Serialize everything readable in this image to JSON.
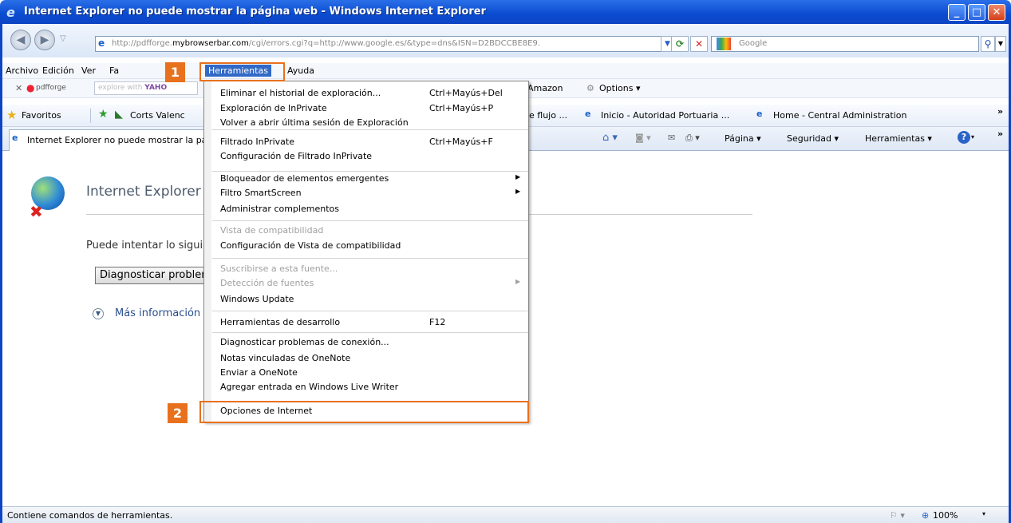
{
  "window": {
    "title": "Internet Explorer no puede mostrar la página web - Windows Internet Explorer",
    "address_prefix": "http://pdfforge.",
    "address_domain": "mybrowserbar.com",
    "address_suffix": "/cgi/errors.cgi?q=http://www.google.es/&type=dns&ISN=D2BDCCBE8E9.",
    "search_placeholder": "Google"
  },
  "menubar": {
    "items": [
      "Archivo",
      "Edición",
      "Ver",
      "Fa",
      "Herramientas",
      "Ayuda"
    ]
  },
  "toolbar2": {
    "close": "✕",
    "brand": "pdfforge",
    "search_placeholder": "explore with",
    "yahoo": "YAHO",
    "amazon": "Amazon",
    "options": "Options ▾"
  },
  "favorites": {
    "label": "Favoritos",
    "items": [
      "Corts Valenc",
      "e flujo ...",
      "Inicio - Autoridad Portuaria ...",
      "Home - Central Administration"
    ],
    "more": "»"
  },
  "tab": {
    "label": "Internet Explorer no puede mostrar la página web",
    "commands": [
      "Página ▾",
      "Seguridad ▾",
      "Herramientas ▾"
    ],
    "more": "»"
  },
  "content": {
    "heading": "Internet Explorer no puede mostrar la página web",
    "suggestion": "Puede intentar lo siguiente:",
    "diagnose_button": "Diagnosticar problemas de conexión",
    "more_info": "Más información"
  },
  "tools_menu": {
    "groups": [
      [
        {
          "label": "Eliminar el historial de exploración...",
          "shortcut": "Ctrl+Mayús+Del",
          "enabled": true
        },
        {
          "label": "Exploración de InPrivate",
          "shortcut": "Ctrl+Mayús+P",
          "enabled": true
        },
        {
          "label": "Volver a abrir última sesión de Exploración",
          "shortcut": "",
          "enabled": true
        }
      ],
      [
        {
          "label": "Filtrado InPrivate",
          "shortcut": "Ctrl+Mayús+F",
          "enabled": true
        },
        {
          "label": "Configuración de Filtrado InPrivate",
          "shortcut": "",
          "enabled": true
        }
      ],
      [
        {
          "label": "Bloqueador de elementos emergentes",
          "shortcut": "",
          "enabled": true,
          "submenu": true
        },
        {
          "label": "Filtro SmartScreen",
          "shortcut": "",
          "enabled": true,
          "submenu": true
        },
        {
          "label": "Administrar complementos",
          "shortcut": "",
          "enabled": true
        }
      ],
      [
        {
          "label": "Vista de compatibilidad",
          "shortcut": "",
          "enabled": false
        },
        {
          "label": "Configuración de Vista de compatibilidad",
          "shortcut": "",
          "enabled": true
        }
      ],
      [
        {
          "label": "Suscribirse a esta fuente...",
          "shortcut": "",
          "enabled": false
        },
        {
          "label": "Detección de fuentes",
          "shortcut": "",
          "enabled": false,
          "submenu": true
        },
        {
          "label": "Windows Update",
          "shortcut": "",
          "enabled": true
        }
      ],
      [
        {
          "label": "Herramientas de desarrollo",
          "shortcut": "F12",
          "enabled": true
        }
      ],
      [
        {
          "label": "Diagnosticar problemas de conexión...",
          "shortcut": "",
          "enabled": true
        },
        {
          "label": "Notas vinculadas de OneNote",
          "shortcut": "",
          "enabled": true
        },
        {
          "label": "Enviar a OneNote",
          "shortcut": "",
          "enabled": true
        },
        {
          "label": "Agregar entrada en Windows Live Writer",
          "shortcut": "",
          "enabled": true
        }
      ],
      [
        {
          "label": "Opciones de Internet",
          "shortcut": "",
          "enabled": true
        }
      ]
    ]
  },
  "callouts": [
    "1",
    "2"
  ],
  "statusbar": {
    "text": "Contiene comandos de herramientas.",
    "zoom": "100%"
  },
  "colors": {
    "accent": "#e8711d",
    "titlebar": "#0d46c4"
  }
}
